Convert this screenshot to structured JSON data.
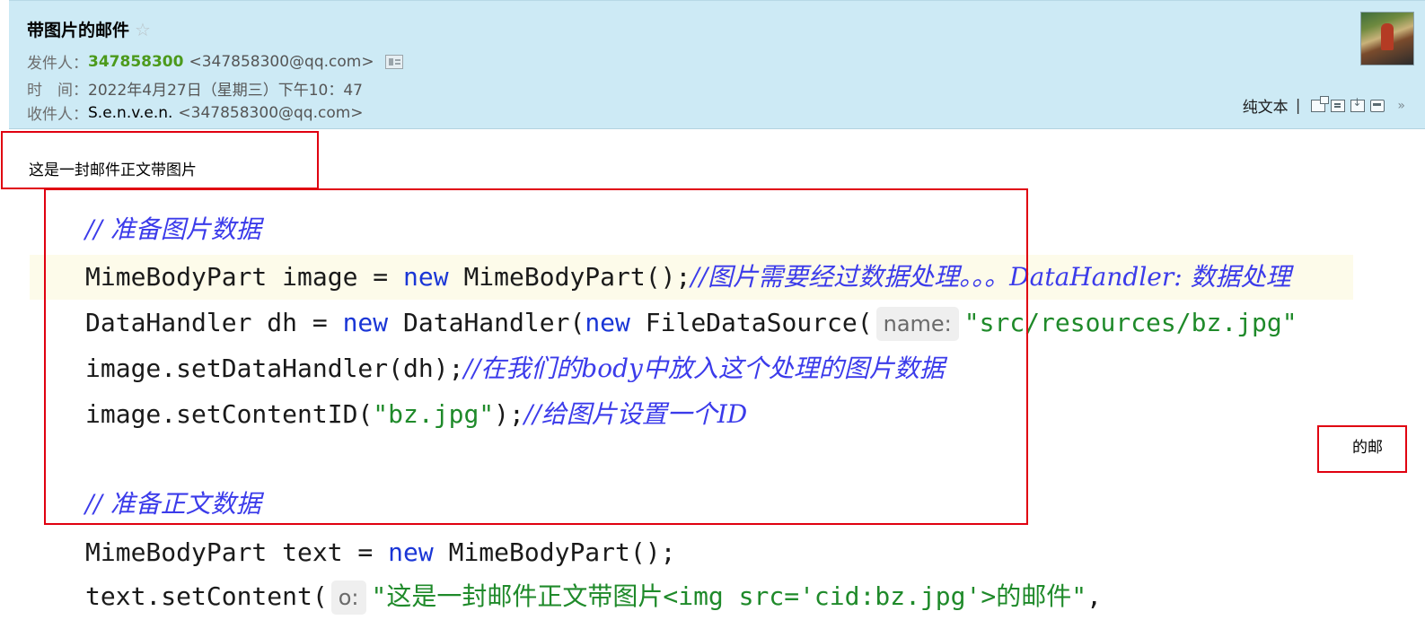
{
  "mail": {
    "subject": "带图片的邮件",
    "star_icon": "☆",
    "sender_label": "发件人：",
    "sender_name": "347858300",
    "sender_addr": "<347858300@qq.com>",
    "time_label": "时　间：",
    "time_value": "2022年4月27日（星期三）下午10：47",
    "recipient_label": "收件人：",
    "recipient_name": "S.e.n.v.e.n.",
    "recipient_addr": "<347858300@qq.com>"
  },
  "toolbar": {
    "plain_text": "纯文本",
    "separator": "|",
    "chevron": "»"
  },
  "body": {
    "text": "这是一封邮件正文带图片",
    "tail": "的邮"
  },
  "code": {
    "l1_comment": "// 准备图片数据",
    "l2_a": "MimeBodyPart image = ",
    "l2_kw": "new",
    "l2_b": " MimeBodyPart();",
    "l2_comment": "//图片需要经过数据处理。。。DataHandler: 数据处理",
    "l3_a": "DataHandler dh = ",
    "l3_kw1": "new",
    "l3_b": " DataHandler(",
    "l3_kw2": "new",
    "l3_c": " FileDataSource(",
    "l3_hint": "name:",
    "l3_str": "\"src/resources/bz.jpg\"",
    "l4_a": "image.setDataHandler(dh);",
    "l4_comment": "//在我们的body中放入这个处理的图片数据",
    "l5_a": "image.setContentID(",
    "l5_str": "\"bz.jpg\"",
    "l5_b": ");",
    "l5_comment": "//给图片设置一个ID",
    "l7_comment": "// 准备正文数据",
    "l8_a": "MimeBodyPart text = ",
    "l8_kw": "new",
    "l8_b": " MimeBodyPart();",
    "l9_a": "text.setContent(",
    "l9_hint": "o:",
    "l9_str": "\"这是一封邮件正文带图片<img src='cid:bz.jpg'>的邮件\"",
    "l9_b": ","
  },
  "colors": {
    "header_bg": "#cdeaf5",
    "sender_green": "#4c9a1c",
    "annotation_red": "#e00010",
    "keyword_blue": "#1a36d6",
    "comment_blue": "#3b3bea",
    "string_green": "#1f8a2a"
  }
}
